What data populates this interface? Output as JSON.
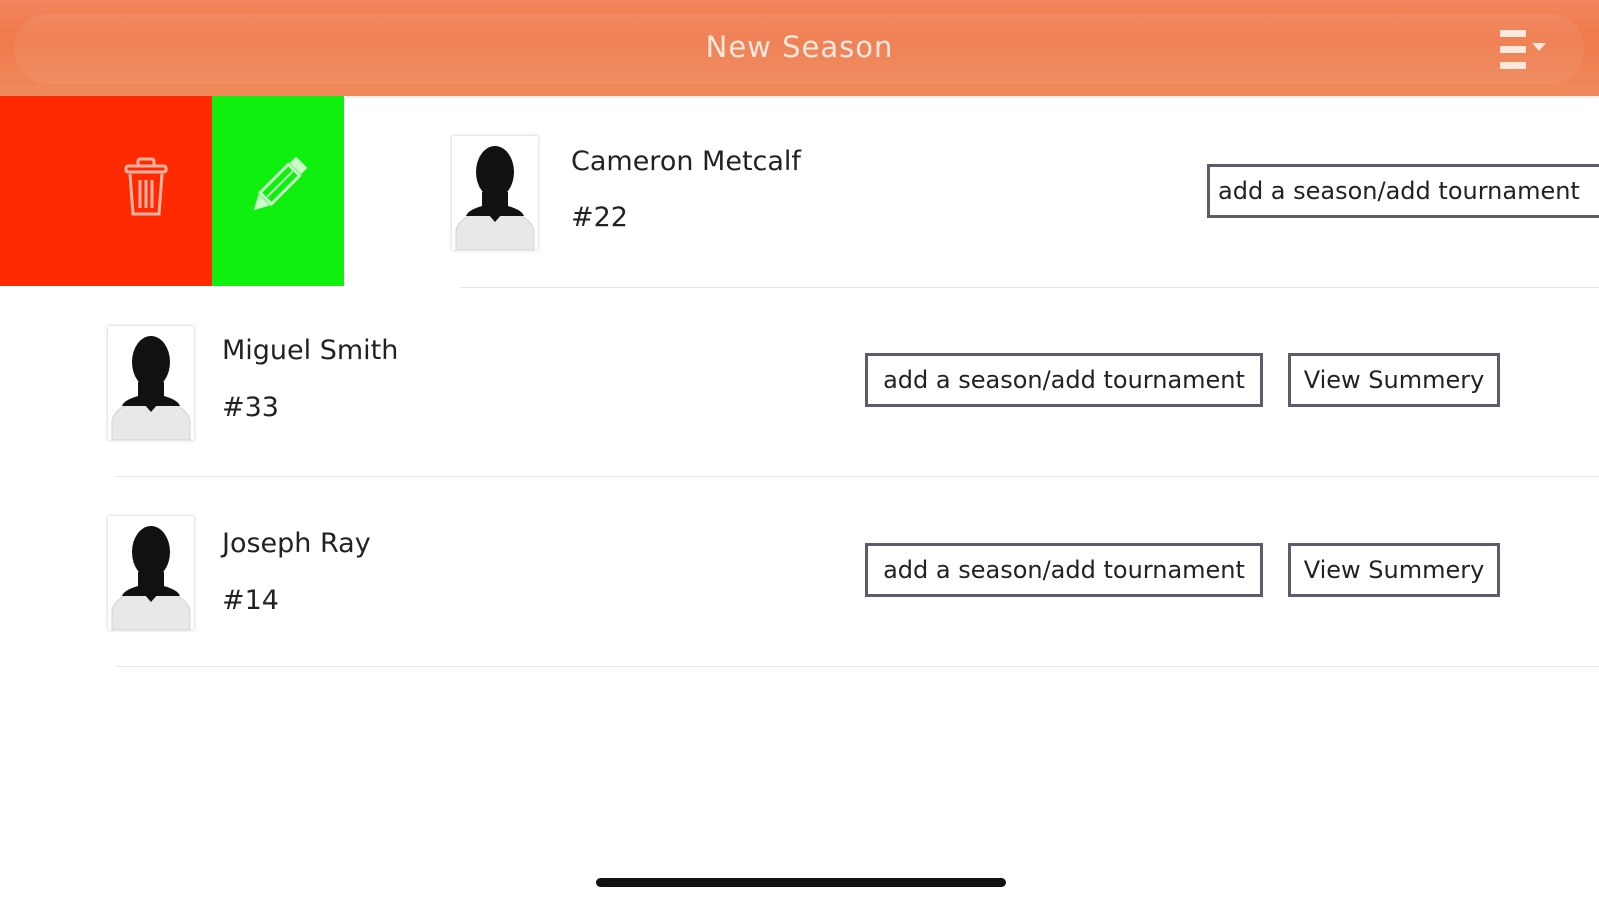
{
  "navbar": {
    "title": "New Season",
    "menu_icon": "hamburger-menu-dropdown-icon"
  },
  "swipe_actions": {
    "delete_icon": "trash-icon",
    "edit_icon": "pencil-icon",
    "delete_color": "#ff2a00",
    "edit_color": "#0ff00f"
  },
  "players": [
    {
      "name": "Cameron Metcalf",
      "number": "#22",
      "add_label": "add a season/add tournament"
    },
    {
      "name": "Miguel Smith",
      "number": "#33",
      "add_label": "add a season/add tournament",
      "summary_label": "View Summery"
    },
    {
      "name": "Joseph Ray",
      "number": "#14",
      "add_label": "add a season/add tournament",
      "summary_label": "View Summery"
    }
  ],
  "colors": {
    "navbar": "#ef7a4b",
    "navbar_text": "#fde8de",
    "button_border": "#5c5c6e"
  }
}
